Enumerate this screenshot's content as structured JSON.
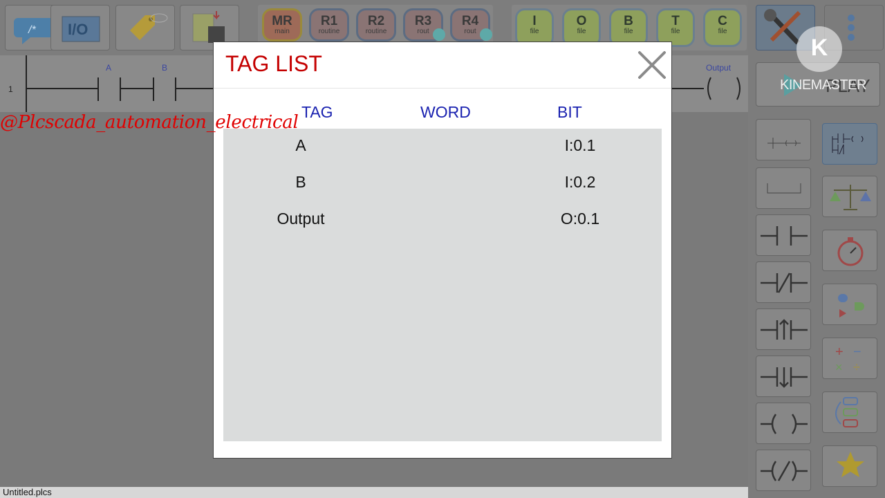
{
  "app": {
    "routines": [
      {
        "label": "MR",
        "sub": "main"
      },
      {
        "label": "R1",
        "sub": "routine"
      },
      {
        "label": "R2",
        "sub": "routine"
      },
      {
        "label": "R3",
        "sub": "rout"
      },
      {
        "label": "R4",
        "sub": "rout"
      }
    ],
    "files": [
      {
        "label": "I",
        "sub": "file"
      },
      {
        "label": "O",
        "sub": "file"
      },
      {
        "label": "B",
        "sub": "file"
      },
      {
        "label": "T",
        "sub": "file"
      },
      {
        "label": "C",
        "sub": "file"
      }
    ],
    "toolbar_icons": [
      "comment-icon",
      "io-icon",
      "tag-icon",
      "chip-transfer-icon"
    ],
    "play_label": "PLAY"
  },
  "ladder": {
    "rung_number": "1",
    "contact_a_label": "A",
    "contact_b_label": "B",
    "output_label": "Output"
  },
  "palette": {
    "left": [
      "branch-icon",
      "empty-rung-icon",
      "no-contact-icon",
      "nc-contact-icon",
      "rising-edge-icon",
      "falling-edge-icon",
      "coil-icon",
      "negated-coil-icon"
    ],
    "right": [
      "instructions-icon",
      "compare-icon",
      "timer-icon",
      "logic-gates-icon",
      "math-icon",
      "program-control-icon",
      "favorites-icon"
    ]
  },
  "dialog": {
    "title": "TAG LIST",
    "columns": {
      "tag": "TAG",
      "word": "WORD",
      "bit": "BIT"
    },
    "rows": [
      {
        "tag": "A",
        "word": "",
        "bit": "I:0.1"
      },
      {
        "tag": "B",
        "word": "",
        "bit": "I:0.2"
      },
      {
        "tag": "Output",
        "word": "",
        "bit": "O:0.1"
      }
    ]
  },
  "status": {
    "filename": "Untitled.plcs"
  },
  "overlay": {
    "watermark": "@Plcscada_automation_electrical",
    "kinemaster_text": "KINEMASTER",
    "kinemaster_logo": "K"
  },
  "colors": {
    "dialog_title": "#c40000",
    "column_header": "#1a22b0",
    "table_background": "#dadcdc",
    "watermark": "#e00000"
  }
}
